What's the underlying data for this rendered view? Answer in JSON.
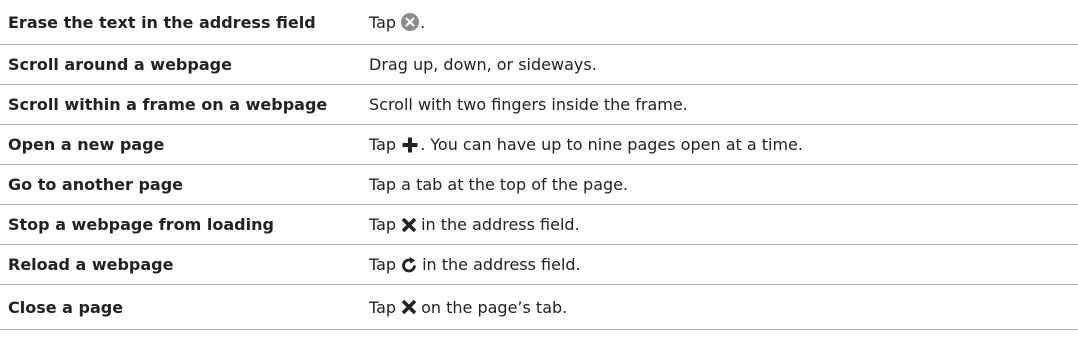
{
  "rows": [
    {
      "task": "Erase the text in the address field",
      "before": "Tap",
      "icon": "clear-circle-icon",
      "after": "."
    },
    {
      "task": "Scroll around a webpage",
      "before": "Drag up, down, or sideways.",
      "icon": "",
      "after": ""
    },
    {
      "task": "Scroll within a frame on a webpage",
      "before": "Scroll with two fingers inside the frame.",
      "icon": "",
      "after": ""
    },
    {
      "task": "Open a new page",
      "before": "Tap",
      "icon": "plus-icon",
      "after": ". You can have up to nine pages open at a time."
    },
    {
      "task": "Go to another page",
      "before": "Tap a tab at the top of the page.",
      "icon": "",
      "after": ""
    },
    {
      "task": "Stop a webpage from loading",
      "before": "Tap",
      "icon": "close-x-icon",
      "after": "in the address field."
    },
    {
      "task": "Reload a webpage",
      "before": "Tap",
      "icon": "reload-icon",
      "after": "in the address field."
    },
    {
      "task": "Close a page",
      "before": "Tap",
      "icon": "close-x-icon",
      "after": "on the page’s tab."
    }
  ]
}
